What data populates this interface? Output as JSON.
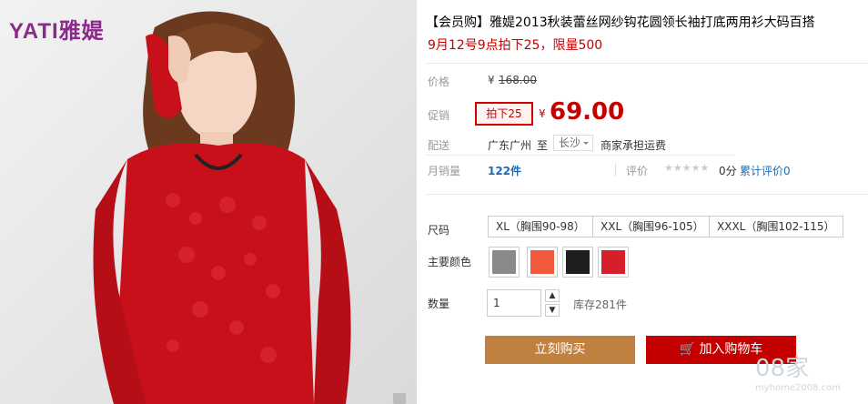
{
  "brand": {
    "logo_text": "YATI雅媞"
  },
  "product": {
    "title": "【会员购】雅媞2013秋装蕾丝网纱钩花圆领长袖打底两用衫大码百搭",
    "subtitle": "9月12号9点拍下25，限量500"
  },
  "price": {
    "label": "价格",
    "yen": "¥",
    "value": "168.00"
  },
  "promo": {
    "label": "促销",
    "tag": "拍下25",
    "yen": "¥",
    "value": "69.00"
  },
  "shipping": {
    "label": "配送",
    "from": "广东广州",
    "to_word": "至",
    "destination": "长沙",
    "fee_note": "商家承担运费"
  },
  "sales": {
    "label": "月销量",
    "count": "122件",
    "rating_label": "评价",
    "stars": "★★★★★",
    "score": "0分",
    "reviews_link": "累计评价0"
  },
  "size": {
    "label": "尺码",
    "options": [
      "XL（胸围90-98）",
      "XXL（胸围96-105）",
      "XXXL（胸围102-115）"
    ]
  },
  "color": {
    "label": "主要颜色",
    "swatches": [
      "#8a8a8a",
      "#f05a3a",
      "#1e1e1e",
      "#d61f2a"
    ]
  },
  "quantity": {
    "label": "数量",
    "value": "1",
    "up": "▲",
    "down": "▼",
    "stock": "库存281件"
  },
  "actions": {
    "buy_now": "立刻购买",
    "add_cart": "加入购物车",
    "buy_color": "#c0803f",
    "cart_color": "#c40000"
  },
  "watermark": {
    "text": "08家",
    "sub": "myhome2008.com"
  }
}
